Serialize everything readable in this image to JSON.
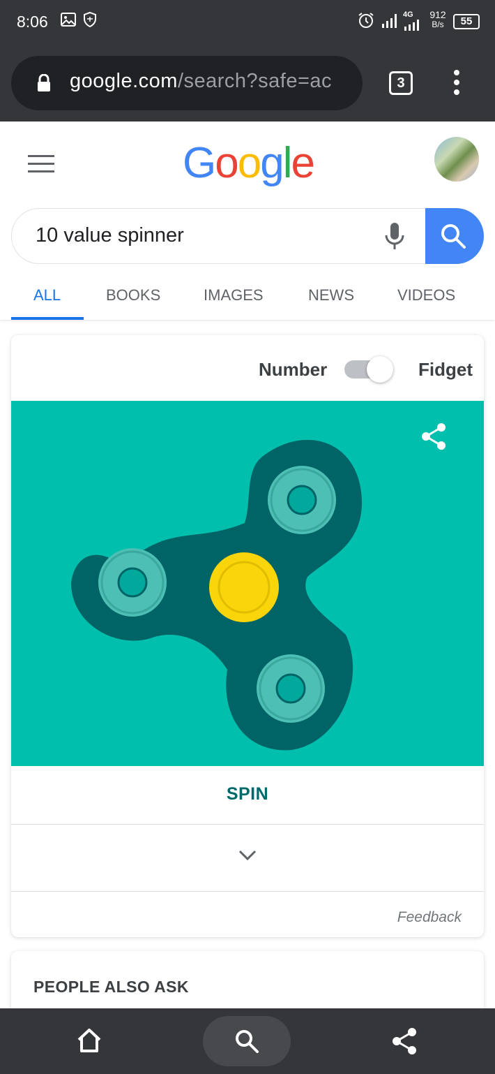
{
  "status_bar": {
    "time": "8:06",
    "network_type": "4G",
    "speed_value": "912",
    "speed_unit": "B/s",
    "battery": "55",
    "icons": [
      "gallery-icon",
      "shield-icon",
      "alarm-icon",
      "signal-icon",
      "signal-icon"
    ]
  },
  "browser": {
    "url_host": "google.com",
    "url_path": "/search?safe=ac",
    "tab_count": "3",
    "icons": [
      "lock-icon",
      "overflow-menu-icon"
    ]
  },
  "google": {
    "logo": [
      "G",
      "o",
      "o",
      "g",
      "l",
      "e"
    ],
    "logo_colors": [
      "#4285f4",
      "#ea4335",
      "#fbbc05",
      "#4285f4",
      "#34a853",
      "#ea4335"
    ],
    "query": "10 value spinner",
    "tabs": [
      "ALL",
      "BOOKS",
      "IMAGES",
      "NEWS",
      "VIDEOS"
    ],
    "active_tab": "ALL",
    "accent_color": "#1a73e8"
  },
  "spinner_widget": {
    "toggle_left": "Number",
    "toggle_right": "Fidget",
    "toggle_state": "Fidget",
    "spin_label": "SPIN",
    "feedback": "Feedback",
    "background_color": "#00bfad",
    "body_color": "#006466",
    "center_color": "#f9d509"
  },
  "people_also_ask": {
    "title": "PEOPLE ALSO ASK"
  },
  "bottom_nav": {
    "icons": [
      "home-icon",
      "search-icon",
      "share-icon"
    ]
  }
}
